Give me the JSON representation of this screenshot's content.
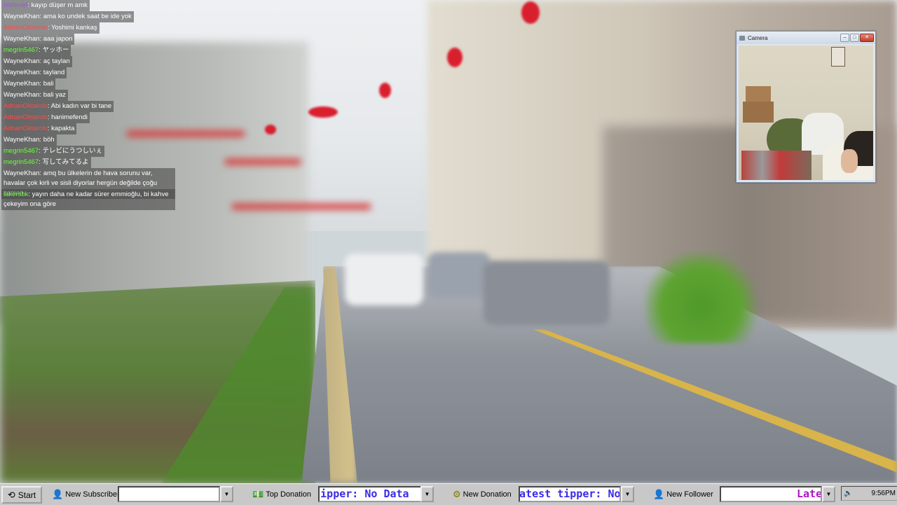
{
  "chat": {
    "messages": [
      {
        "user": "Mehmet",
        "user_color": "#9b59d6",
        "text": "kayıp düşer m amk"
      },
      {
        "user": "WayneKhan",
        "user_color": "#ffffff",
        "text": "ama ko undek saat be ide yok"
      },
      {
        "user": "AdnanOktarolv",
        "user_color": "#ff4a4a",
        "text": "Yoshimi kankaş"
      },
      {
        "user": "WayneKhan",
        "user_color": "#ffffff",
        "text": "aaa japon"
      },
      {
        "user": "megrin5467",
        "user_color": "#6cff3c",
        "text": "ヤッホー"
      },
      {
        "user": "WayneKhan",
        "user_color": "#ffffff",
        "text": "aç taylan"
      },
      {
        "user": "WayneKhan",
        "user_color": "#ffffff",
        "text": "tayland"
      },
      {
        "user": "WayneKhan",
        "user_color": "#ffffff",
        "text": "bali"
      },
      {
        "user": "WayneKhan",
        "user_color": "#ffffff",
        "text": "bali yaz"
      },
      {
        "user": "AdnanOktarolv",
        "user_color": "#ff4a4a",
        "text": "Abi kadın var bi tane"
      },
      {
        "user": "AdnanOktarolv",
        "user_color": "#ff4a4a",
        "text": "hanimefendi"
      },
      {
        "user": "AdnanOktarolv",
        "user_color": "#ff4a4a",
        "text": "kapakta"
      },
      {
        "user": "WayneKhan",
        "user_color": "#ffffff",
        "text": "böh"
      },
      {
        "user": "megrin5467",
        "user_color": "#6cff3c",
        "text": "テレビにうつしいぇ"
      },
      {
        "user": "megrin5467",
        "user_color": "#6cff3c",
        "text": "写してみてるよ"
      },
      {
        "user": "WayneKhan",
        "user_color": "#ffffff",
        "text": "amq bu ülkelerin de hava sorunu var, havalar çok kirli ve sisli diyorlar hergün değilde çoğu zaman"
      },
      {
        "user": "lakersbk",
        "user_color": "#6cff3c",
        "text": "yayın daha ne kadar sürer emmioğlu, bi kahve çekeyim ona göre"
      }
    ]
  },
  "camera": {
    "title": "Camera",
    "minimize": "–",
    "maximize": "□",
    "close": "✕"
  },
  "taskbar": {
    "start_label": "Start",
    "new_subscriber_label": "New Subscriber",
    "new_subscriber_value": "",
    "top_donation_label": "Top Donation",
    "top_donation_value": "Top tipper: No Data",
    "top_donation_color": "#3a2ae8",
    "new_donation_label": "New Donation",
    "new_donation_value": "Latest tipper: No",
    "new_donation_color": "#3a2ae8",
    "new_follower_label": "New Follower",
    "new_follower_value": "Late",
    "new_follower_color": "#b012c8",
    "dropdown_glyph": "▼",
    "clock": "9:56PM"
  }
}
